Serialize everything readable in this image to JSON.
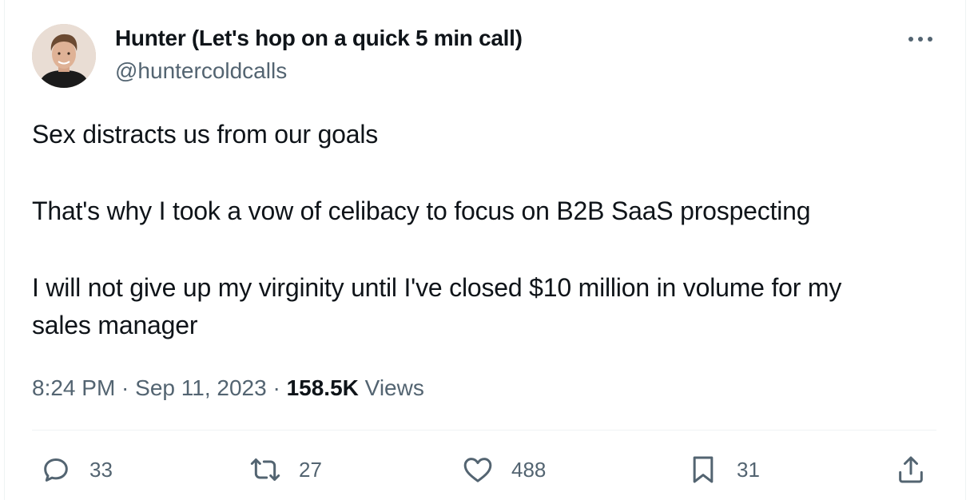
{
  "author": {
    "name": "Hunter (Let's hop on a quick 5 min call)",
    "handle": "@huntercoldcalls"
  },
  "icons": {
    "more": "more-horizontal-icon",
    "reply": "reply-icon",
    "retweet": "retweet-icon",
    "like": "heart-icon",
    "bookmark": "bookmark-icon",
    "share": "share-icon"
  },
  "tweet": {
    "lines": [
      "Sex distracts us from our goals",
      "That's why I took a vow of celibacy to focus on B2B SaaS prospecting",
      "I will not give up my virginity until I've closed $10 million in volume for my",
      "sales manager"
    ]
  },
  "meta": {
    "time": "8:24 PM",
    "sep1": " · ",
    "date": "Sep 11, 2023",
    "sep2": " · ",
    "views_count": "158.5K",
    "views_label": " Views"
  },
  "actions": {
    "replies": "33",
    "retweets": "27",
    "likes": "488",
    "bookmarks": "31"
  },
  "colors": {
    "text": "#0f1419",
    "secondary": "#536471",
    "divider": "#eff3f4"
  }
}
